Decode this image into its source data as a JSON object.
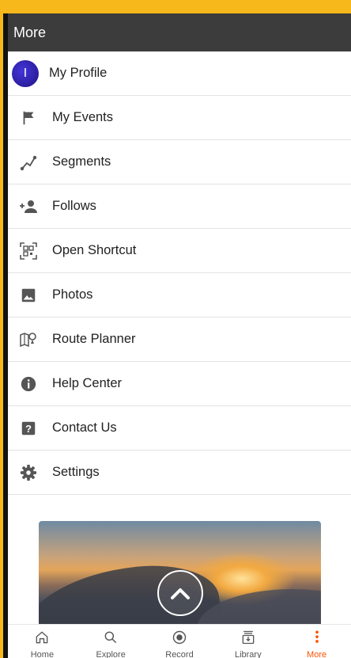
{
  "appbar": {
    "title": "More"
  },
  "menu": [
    {
      "label": "My Profile",
      "icon": "avatar",
      "initial": "I"
    },
    {
      "label": "My Events",
      "icon": "flag-icon"
    },
    {
      "label": "Segments",
      "icon": "segments-icon"
    },
    {
      "label": "Follows",
      "icon": "add-person-icon"
    },
    {
      "label": "Open Shortcut",
      "icon": "qr-scan-icon"
    },
    {
      "label": "Photos",
      "icon": "photos-icon"
    },
    {
      "label": "Route Planner",
      "icon": "route-planner-icon"
    },
    {
      "label": "Help Center",
      "icon": "info-icon"
    },
    {
      "label": "Contact Us",
      "icon": "help-question-icon"
    },
    {
      "label": "Settings",
      "icon": "gear-icon"
    }
  ],
  "bottom_nav": [
    {
      "label": "Home",
      "icon": "home-icon"
    },
    {
      "label": "Explore",
      "icon": "search-icon"
    },
    {
      "label": "Record",
      "icon": "record-icon"
    },
    {
      "label": "Library",
      "icon": "library-icon"
    },
    {
      "label": "More",
      "icon": "more-vertical-icon",
      "active": true
    }
  ],
  "colors": {
    "appbar": "#3c3c3c",
    "accent": "#fc5200",
    "frame": "#f6b81a"
  }
}
